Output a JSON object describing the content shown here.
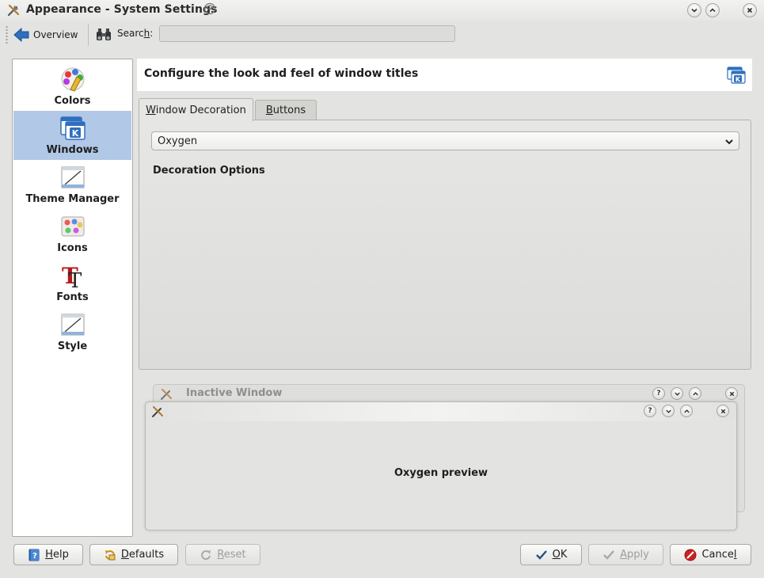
{
  "window": {
    "title": "Appearance - System Settings"
  },
  "toolbar": {
    "overview_label": "Overview",
    "search_label": "Search:",
    "search_value": ""
  },
  "sidebar": {
    "items": [
      {
        "label": "Colors",
        "icon": "colors-icon"
      },
      {
        "label": "Windows",
        "icon": "windows-icon",
        "selected": true
      },
      {
        "label": "Theme Manager",
        "icon": "theme-manager-icon"
      },
      {
        "label": "Icons",
        "icon": "icons-icon"
      },
      {
        "label": "Fonts",
        "icon": "fonts-icon"
      },
      {
        "label": "Style",
        "icon": "style-icon"
      }
    ]
  },
  "header": {
    "text": "Configure the look and feel of window titles"
  },
  "tabs": [
    {
      "label": "Window Decoration",
      "mnemonic": "W",
      "rest": "indow Decoration",
      "active": true
    },
    {
      "label": "Buttons",
      "mnemonic": "B",
      "rest": "uttons",
      "active": false
    }
  ],
  "decoration": {
    "selected": "Oxygen",
    "options_title": "Decoration Options"
  },
  "preview": {
    "inactive_title": "Inactive Window",
    "active_text": "Oxygen preview"
  },
  "buttons": {
    "help": {
      "mnemonic": "H",
      "rest": "elp"
    },
    "defaults": {
      "mnemonic": "D",
      "rest": "efaults"
    },
    "reset": {
      "mnemonic": "R",
      "rest": "eset"
    },
    "ok": {
      "mnemonic": "O",
      "rest": "K"
    },
    "apply": {
      "mnemonic": "A",
      "rest": "pply"
    },
    "cancel": {
      "pre": "Cance",
      "mnemonic": "l"
    }
  },
  "colors": {
    "selection": "#b1c8e6",
    "accent_blue": "#2f6fbf",
    "cancel_red": "#cc2222"
  }
}
